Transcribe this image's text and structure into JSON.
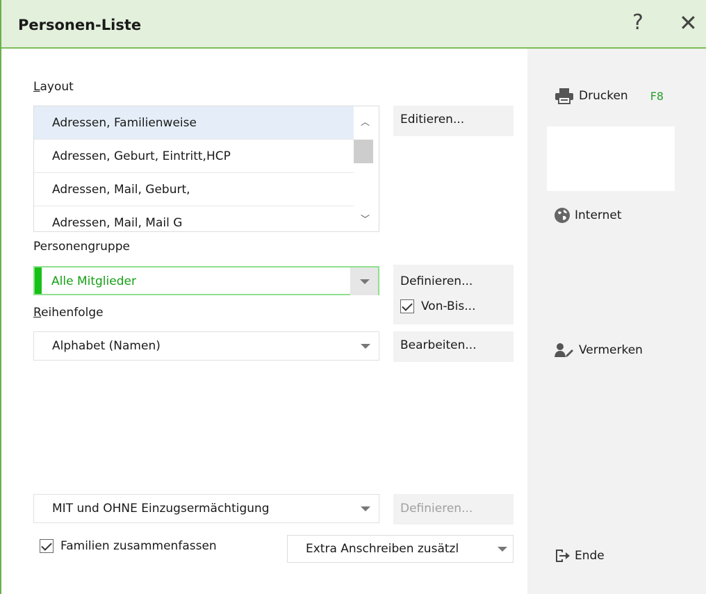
{
  "window": {
    "title": "Personen-Liste",
    "help_label": "?",
    "close_label": "✕"
  },
  "layout": {
    "label": "Layout",
    "items": [
      "Adressen, Familienweise",
      "Adressen, Geburt, Eintritt,HCP",
      "Adressen, Mail, Geburt,",
      "Adressen, Mail, Mail G"
    ],
    "selected_index": 0,
    "edit_button": "Editieren..."
  },
  "personengruppe": {
    "label": "Personengruppe",
    "value": "Alle Mitglieder",
    "define_button": "Definieren...",
    "vonbis_label": "Von-Bis...",
    "vonbis_checked": true
  },
  "reihenfolge": {
    "label": "Reihenfolge",
    "value": "Alphabet (Namen)",
    "edit_button": "Bearbeiten..."
  },
  "einzug": {
    "value": "MIT und OHNE Einzugsermächtigung",
    "define_button": "Definieren..."
  },
  "familien": {
    "label": "Familien zusammenfassen",
    "checked": true
  },
  "extra": {
    "value": "Extra Anschreiben zusätzl"
  },
  "sidebar": {
    "drucken": "Drucken",
    "drucken_shortcut": "F8",
    "internet": "Internet",
    "vermerken": "Vermerken",
    "ende": "Ende"
  },
  "colors": {
    "accent_green": "#16c016",
    "title_bg": "#e3f0dc",
    "panel_bg": "#f2f2f2"
  }
}
